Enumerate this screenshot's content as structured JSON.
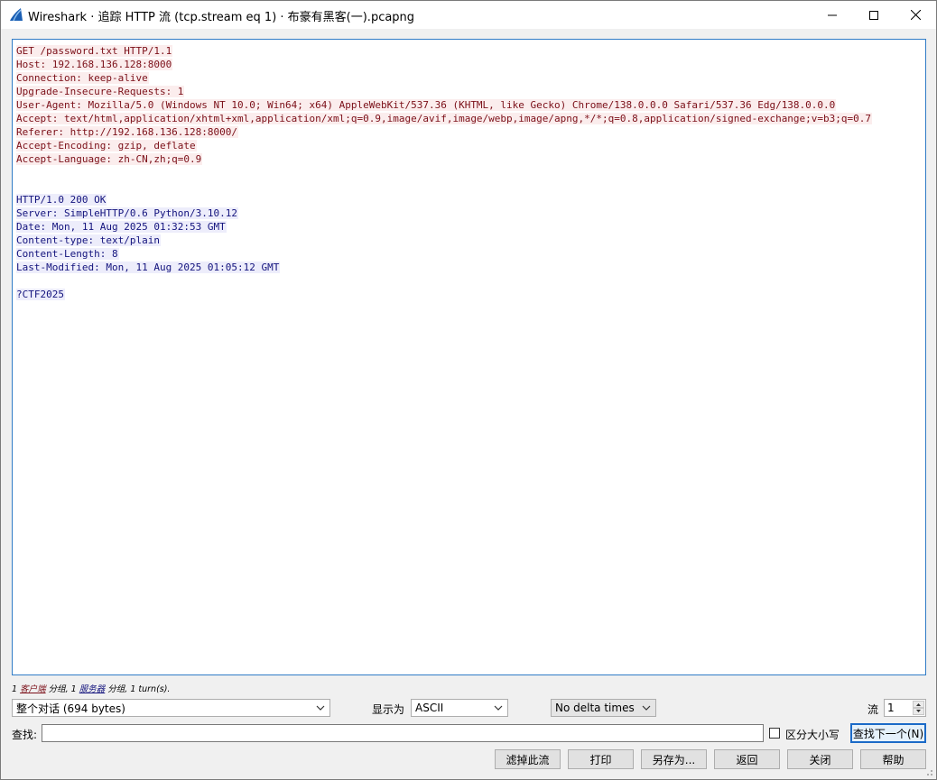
{
  "window": {
    "title": "Wireshark · 追踪 HTTP 流 (tcp.stream eq 1) · 布豪有黑客(一).pcapng",
    "controls": [
      "minimize-icon",
      "maximize-icon",
      "close-icon"
    ]
  },
  "stream": {
    "client_lines": [
      "GET /password.txt HTTP/1.1",
      "Host: 192.168.136.128:8000",
      "Connection: keep-alive",
      "Upgrade-Insecure-Requests: 1",
      "User-Agent: Mozilla/5.0 (Windows NT 10.0; Win64; x64) AppleWebKit/537.36 (KHTML, like Gecko) Chrome/138.0.0.0 Safari/537.36 Edg/138.0.0.0",
      "Accept: text/html,application/xhtml+xml,application/xml;q=0.9,image/avif,image/webp,image/apng,*/*;q=0.8,application/signed-exchange;v=b3;q=0.7",
      "Referer: http://192.168.136.128:8000/",
      "Accept-Encoding: gzip, deflate",
      "Accept-Language: zh-CN,zh;q=0.9"
    ],
    "server_lines": [
      "HTTP/1.0 200 OK",
      "Server: SimpleHTTP/0.6 Python/3.10.12",
      "Date: Mon, 11 Aug 2025 01:32:53 GMT",
      "Content-type: text/plain",
      "Content-Length: 8",
      "Last-Modified: Mon, 11 Aug 2025 01:05:12 GMT",
      "",
      "?CTF2025"
    ],
    "colors": {
      "client_bg": "#fbeded",
      "client_fg": "#7b0f18",
      "server_bg": "#ededfb",
      "server_fg": "#13137d"
    }
  },
  "summary": {
    "count1": "1",
    "client_label": "客户端",
    "mid": "分组, 1",
    "server_label": "服务器",
    "tail": "分组, 1 turn(s)."
  },
  "controls": {
    "conversation_value": "整个对话 (694 bytes)",
    "show_as_label": "显示为",
    "show_as_value": "ASCII",
    "delta_value": "No delta times",
    "stream_label": "流",
    "stream_value": "1",
    "find_label": "查找:",
    "find_value": "",
    "case_label": "区分大小写",
    "find_next_label": "查找下一个(N)"
  },
  "buttons": {
    "filter_out": "滤掉此流",
    "print": "打印",
    "save_as": "另存为...",
    "back": "返回",
    "close": "关闭",
    "help": "帮助"
  }
}
